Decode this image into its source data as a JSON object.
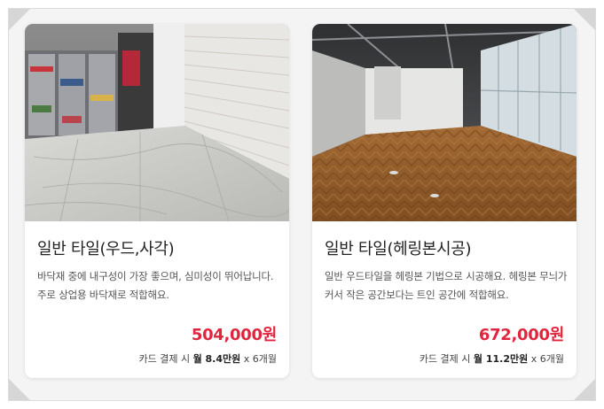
{
  "cards": [
    {
      "title": "일반 타일(우드,사각)",
      "description": "바닥재 중에 내구성이 가장 좋으며, 심미성이 뛰어납니다.주로 상업용 바닥재로 적합해요.",
      "price": "504,000원",
      "installment": {
        "prefix": "카드 결제 시",
        "monthly": "월 8.4만원",
        "suffix": "x 6개월"
      }
    },
    {
      "title": "일반 타일(헤링본시공)",
      "description": "일반 우드타일을 헤링본 기법으로 시공해요. 헤링본 무늬가 커서 작은 공간보다는 트인 공간에 적합해요.",
      "price": "672,000원",
      "installment": {
        "prefix": "카드 결제 시",
        "monthly": "월 11.2만원",
        "suffix": "x 6개월"
      }
    }
  ],
  "colors": {
    "price": "#e0263f",
    "frame": "#f4f4f4",
    "card": "#ffffff"
  }
}
